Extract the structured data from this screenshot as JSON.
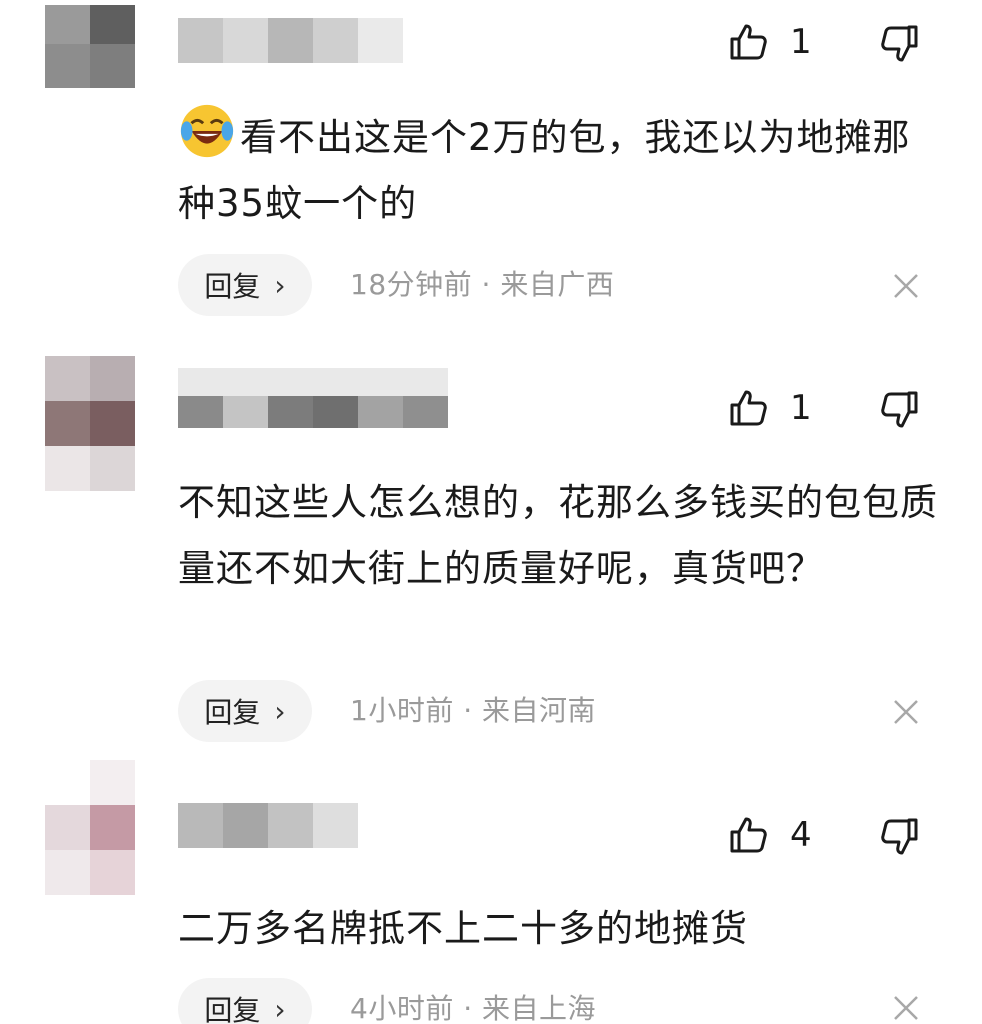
{
  "comments": [
    {
      "likes": "1",
      "text": "看不出这是个2万的包，我还以为地摊那种35蚊一个的",
      "emoji": "crying-laughing-emoji",
      "reply_label": "回复",
      "meta": "18分钟前 · 来自广西"
    },
    {
      "likes": "1",
      "text": "不知这些人怎么想的，花那么多钱买的包包质量还不如大街上的质量好呢，真货吧？",
      "reply_label": "回复",
      "meta": "1小时前 · 来自河南"
    },
    {
      "likes": "4",
      "text": "二万多名牌抵不上二十多的地摊货",
      "reply_label": "回复",
      "meta": "4小时前 · 来自上海"
    }
  ],
  "icons": {
    "like": "thumbs-up-icon",
    "dislike": "thumbs-down-icon",
    "reply_arrow": "chevron-right-icon",
    "close": "close-icon"
  }
}
